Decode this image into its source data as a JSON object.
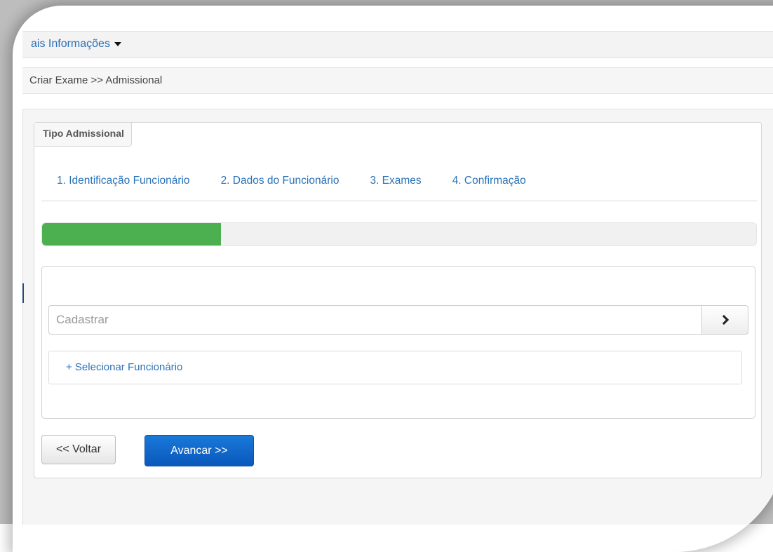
{
  "menu": {
    "label": "ais Informações"
  },
  "breadcrumb": {
    "text": "Criar Exame >> Admissional"
  },
  "panel": {
    "tab_label": "Tipo Admissional"
  },
  "steps": [
    {
      "label": "1. Identificação Funcionário"
    },
    {
      "label": "2. Dados do Funcionário"
    },
    {
      "label": "3. Exames"
    },
    {
      "label": "4. Confirmação"
    }
  ],
  "progress": {
    "fraction": 0.25,
    "fill_color": "#4cb050"
  },
  "search": {
    "placeholder": "Cadastrar",
    "button_icon": "chevron-right-icon"
  },
  "select_employee": {
    "label": "+ Selecionar Funcionário"
  },
  "buttons": {
    "back_label": "<< Voltar",
    "next_label": "Avancar >>"
  },
  "colors": {
    "link": "#2a73b8",
    "primary": "#0a58bc"
  }
}
